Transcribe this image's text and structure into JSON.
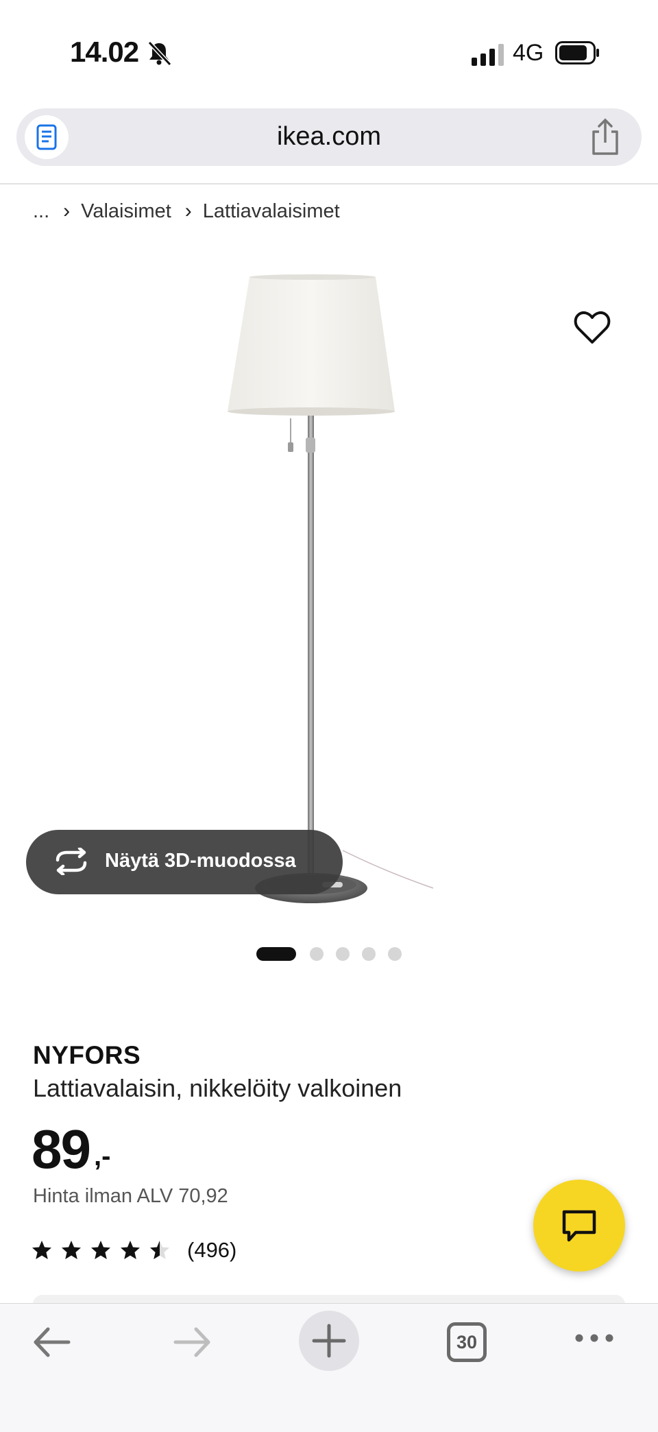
{
  "status_bar": {
    "time": "14.02",
    "network": "4G"
  },
  "browser": {
    "url": "ikea.com",
    "tab_count": "30"
  },
  "breadcrumb": {
    "ellipsis": "...",
    "items": [
      "Valaisimet",
      "Lattiavalaisimet"
    ]
  },
  "gallery": {
    "view_3d_label": "Näytä 3D-muodossa",
    "image_count": 5,
    "active_index": 0
  },
  "product": {
    "name": "NYFORS",
    "description": "Lattiavalaisin, nikkelöity valkoinen",
    "price": "89",
    "price_suffix": ",-",
    "price_vat": "Hinta ilman ALV 70,92",
    "rating": 4.5,
    "review_count": "(496)"
  },
  "colors": {
    "accent_yellow": "#f6d623",
    "text": "#111111"
  }
}
